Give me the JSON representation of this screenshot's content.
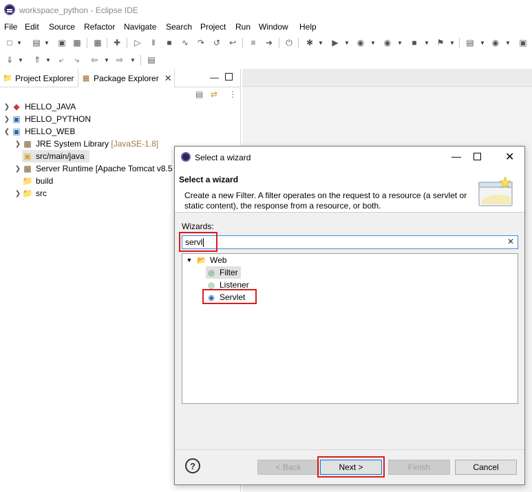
{
  "window": {
    "title": "workspace_python - Eclipse IDE"
  },
  "menubar": [
    "File",
    "Edit",
    "Source",
    "Refactor",
    "Navigate",
    "Search",
    "Project",
    "Run",
    "Window",
    "Help"
  ],
  "tabs": {
    "project_explorer": "Project Explorer",
    "package_explorer": "Package Explorer"
  },
  "tree": {
    "hello_java": "HELLO_JAVA",
    "hello_python": "HELLO_PYTHON",
    "hello_web": "HELLO_WEB",
    "jre_lib": "JRE System Library",
    "jre_version": "[JavaSE-1.8]",
    "src_main_java": "src/main/java",
    "server_runtime": "Server Runtime [Apache Tomcat v8.5",
    "build": "build",
    "src": "src"
  },
  "dialog": {
    "title": "Select a wizard",
    "banner_title": "Select a wizard",
    "banner_desc": "Create a new Filter. A filter operates on the request to a resource (a servlet or static content), the response from a resource, or both.",
    "wizards_label": "Wizards:",
    "filter_value": "servl",
    "items": {
      "web": "Web",
      "filter": "Filter",
      "listener": "Listener",
      "servlet": "Servlet"
    },
    "buttons": {
      "help": "?",
      "back": "< Back",
      "next": "Next >",
      "finish": "Finish",
      "cancel": "Cancel"
    }
  },
  "colors": {
    "highlight_box": "#e01a1a",
    "focus_border": "#3c8ddc",
    "folder": "#d9a53a"
  }
}
